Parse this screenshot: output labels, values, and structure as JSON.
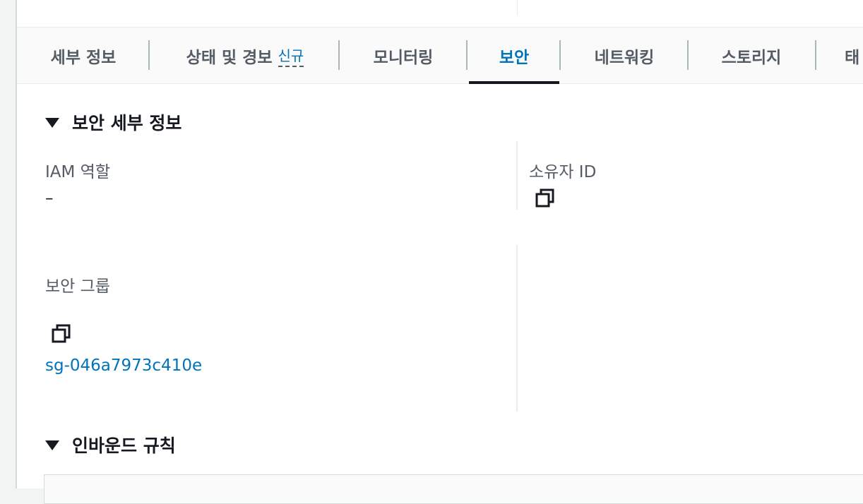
{
  "tabs": [
    {
      "label": "세부 정보"
    },
    {
      "label": "상태 및 경보",
      "badge": "신규"
    },
    {
      "label": "모니터링"
    },
    {
      "label": "보안"
    },
    {
      "label": "네트워킹"
    },
    {
      "label": "스토리지"
    },
    {
      "label": "태"
    }
  ],
  "active_tab": "보안",
  "security_details": {
    "title": "보안 세부 정보",
    "iam_role_label": "IAM 역할",
    "iam_role_value": "–",
    "owner_id_label": "소유자 ID",
    "security_groups_label": "보안 그룹",
    "security_group_link": "sg-046a7973c410e"
  },
  "inbound_rules": {
    "title": "인바운드 규칙"
  },
  "icons": {
    "caret": "caret-down-icon",
    "copy": "copy-icon"
  },
  "colors": {
    "accent": "#0073bb",
    "text": "#16191f",
    "muted": "#545b64"
  }
}
